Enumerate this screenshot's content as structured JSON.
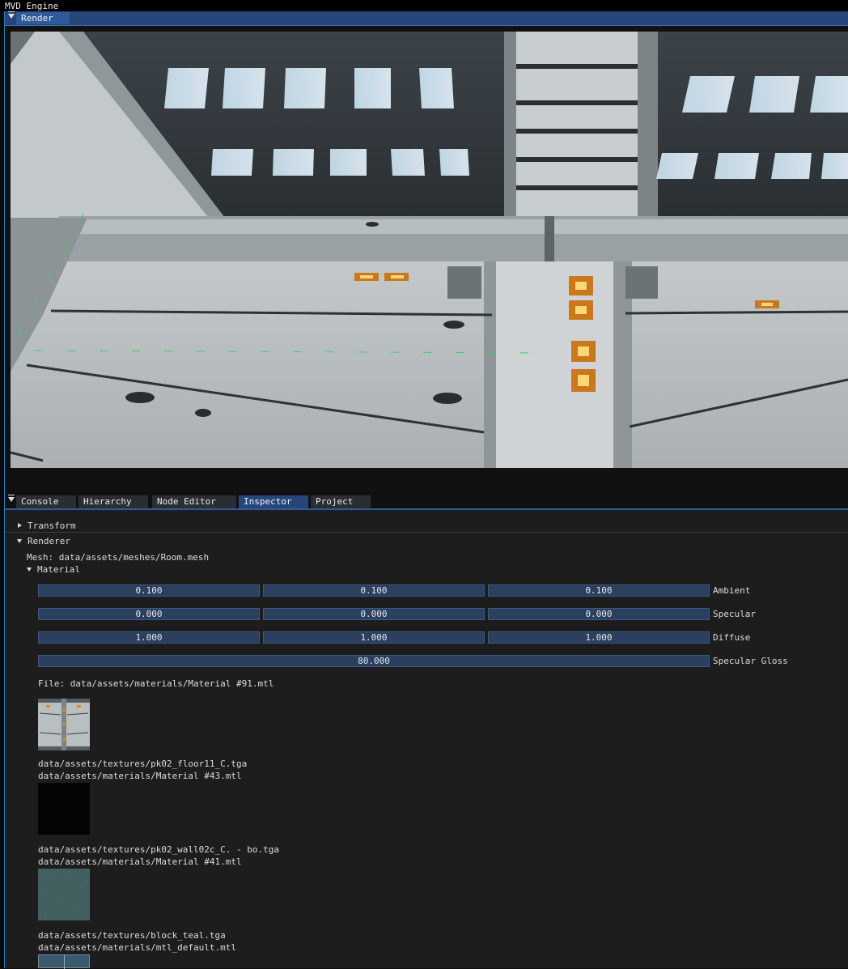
{
  "app": {
    "title": "MVD Engine"
  },
  "render_window": {
    "tab_label": "Render"
  },
  "lower_panel": {
    "tabs": [
      "Console",
      "Hierarchy",
      "Node Editor",
      "Inspector",
      "Project"
    ],
    "active_tab": "Inspector"
  },
  "inspector": {
    "transform_label": "Transform",
    "renderer_label": "Renderer",
    "mesh_line": "Mesh: data/assets/meshes/Room.mesh",
    "material_label": "Material",
    "ambient": {
      "label": "Ambient",
      "values": [
        "0.100",
        "0.100",
        "0.100"
      ]
    },
    "specular": {
      "label": "Specular",
      "values": [
        "0.000",
        "0.000",
        "0.000"
      ]
    },
    "diffuse": {
      "label": "Diffuse",
      "values": [
        "1.000",
        "1.000",
        "1.000"
      ]
    },
    "specular_gloss": {
      "label": "Specular Gloss",
      "value": "80.000"
    },
    "file_line": "File: data/assets/materials/Material #91.mtl",
    "entries": [
      {
        "texture": "data/assets/textures/pk02_floor11_C.tga",
        "material": "data/assets/materials/Material #43.mtl"
      },
      {
        "texture": "data/assets/textures/pk02_wall02c_C. - bo.tga",
        "material": "data/assets/materials/Material #41.mtl"
      },
      {
        "texture": "data/assets/textures/block_teal.tga",
        "material": "data/assets/materials/mtl_default.mtl"
      }
    ]
  },
  "colors": {
    "tab_active": "#26467a",
    "field_bg": "#2b3f5e",
    "panel_bg": "#1d1d1d",
    "accent": "#2b7fb7"
  }
}
